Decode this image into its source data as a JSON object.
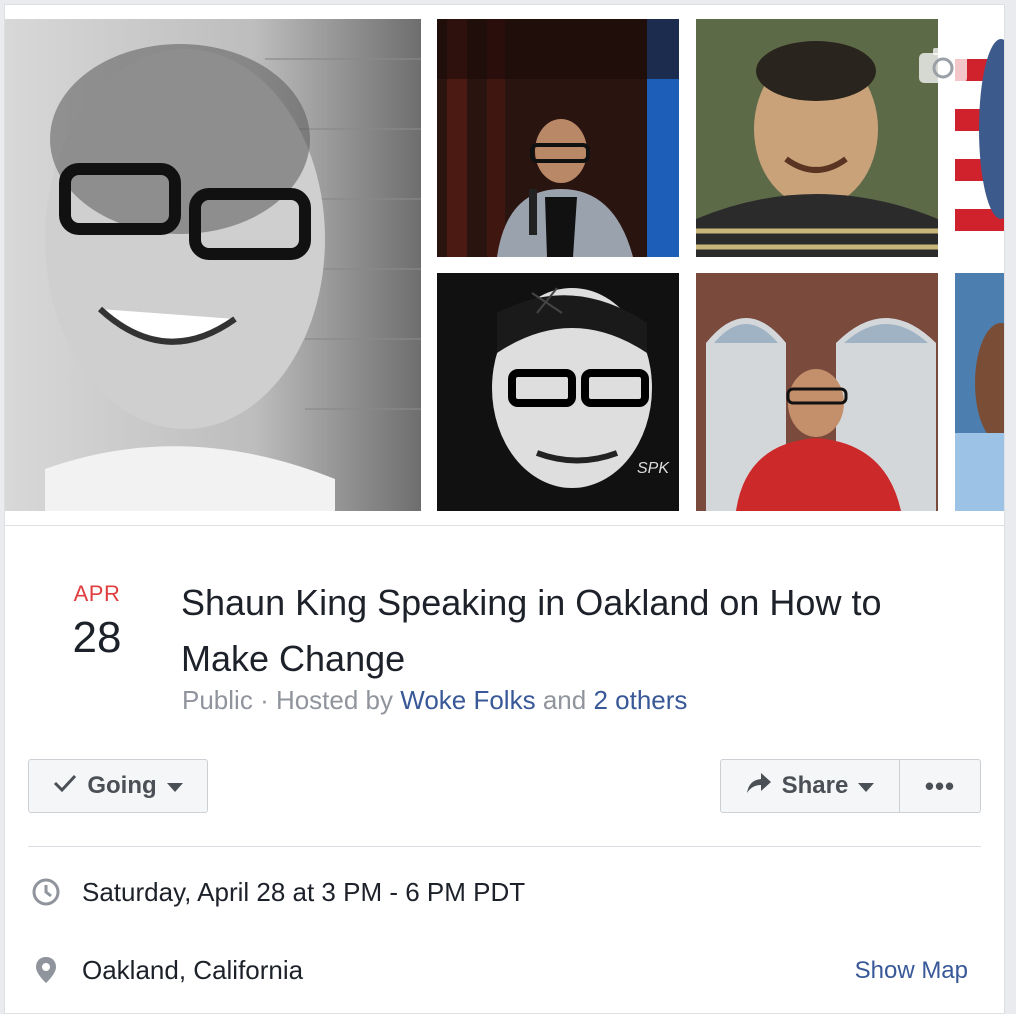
{
  "event": {
    "date_month": "APR",
    "date_day": "28",
    "title": "Shaun King Speaking in Oakland on How to Make Change",
    "privacy": "Public",
    "hosted_by_prefix": "· Hosted by",
    "host_name": "Woke Folks",
    "and_text": "and",
    "others_link": "2 others"
  },
  "actions": {
    "going_label": "Going",
    "share_label": "Share",
    "more_label": "•••"
  },
  "details": {
    "datetime": "Saturday, April 28 at 3 PM - 6 PM PDT",
    "location": "Oakland, California",
    "show_map_label": "Show Map"
  },
  "icons": {
    "camera": "camera-icon",
    "check": "check-icon",
    "share": "share-arrow-icon",
    "clock": "clock-icon",
    "pin": "map-pin-icon"
  },
  "colors": {
    "month_red": "#e03e3e",
    "link_blue": "#385898",
    "button_bg": "#f5f6f7",
    "secondary_text": "#90949c"
  }
}
